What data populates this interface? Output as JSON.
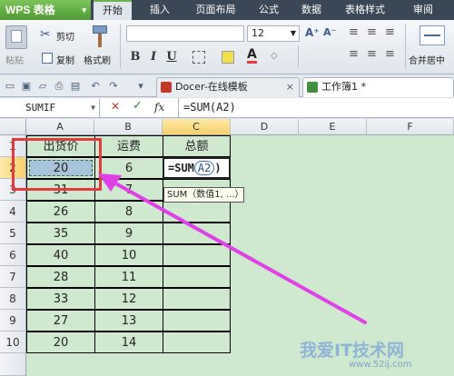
{
  "app": {
    "name": "WPS 表格",
    "menu_arrow": "▾"
  },
  "menus": [
    "开始",
    "插入",
    "页面布局",
    "公式",
    "数据",
    "表格样式",
    "审阅"
  ],
  "ribbon": {
    "cut": "剪切",
    "paste": "粘贴",
    "copy": "复制",
    "format_painter": "格式刷",
    "font_size": "12",
    "merge_center": "合并居中"
  },
  "tabs": {
    "docer": "Docer-在线模板",
    "workbook": "工作簿1 *"
  },
  "formula_bar": {
    "name_box": "SUMIF",
    "cancel": "✕",
    "confirm": "✓",
    "fx": "fx",
    "formula": "=SUM(A2)"
  },
  "columns": [
    "A",
    "B",
    "C",
    "D",
    "E",
    "F"
  ],
  "rows": [
    {
      "num": "1",
      "a": "出货价",
      "b": "运费",
      "c": "总额"
    },
    {
      "num": "2",
      "a": "20",
      "b": "6",
      "c": ""
    },
    {
      "num": "3",
      "a": "31",
      "b": "7",
      "c": ""
    },
    {
      "num": "4",
      "a": "26",
      "b": "8",
      "c": ""
    },
    {
      "num": "5",
      "a": "35",
      "b": "9",
      "c": ""
    },
    {
      "num": "6",
      "a": "40",
      "b": "10",
      "c": ""
    },
    {
      "num": "7",
      "a": "28",
      "b": "11",
      "c": ""
    },
    {
      "num": "8",
      "a": "33",
      "b": "12",
      "c": ""
    },
    {
      "num": "9",
      "a": "27",
      "b": "13",
      "c": ""
    },
    {
      "num": "10",
      "a": "20",
      "b": "14",
      "c": ""
    }
  ],
  "editing": {
    "formula_prefix": "=SUM",
    "reference": "A2",
    "close_paren": ")",
    "tooltip": "SUM（数值1, ...）"
  },
  "watermark": {
    "text": "我爱IT技术网",
    "url": "www.52ij.com"
  },
  "colors": {
    "accent_green": "#6fb34b",
    "highlight_red": "#e23b3b",
    "arrow_magenta": "#e040e8",
    "sheet_green": "#cfe9cf"
  }
}
